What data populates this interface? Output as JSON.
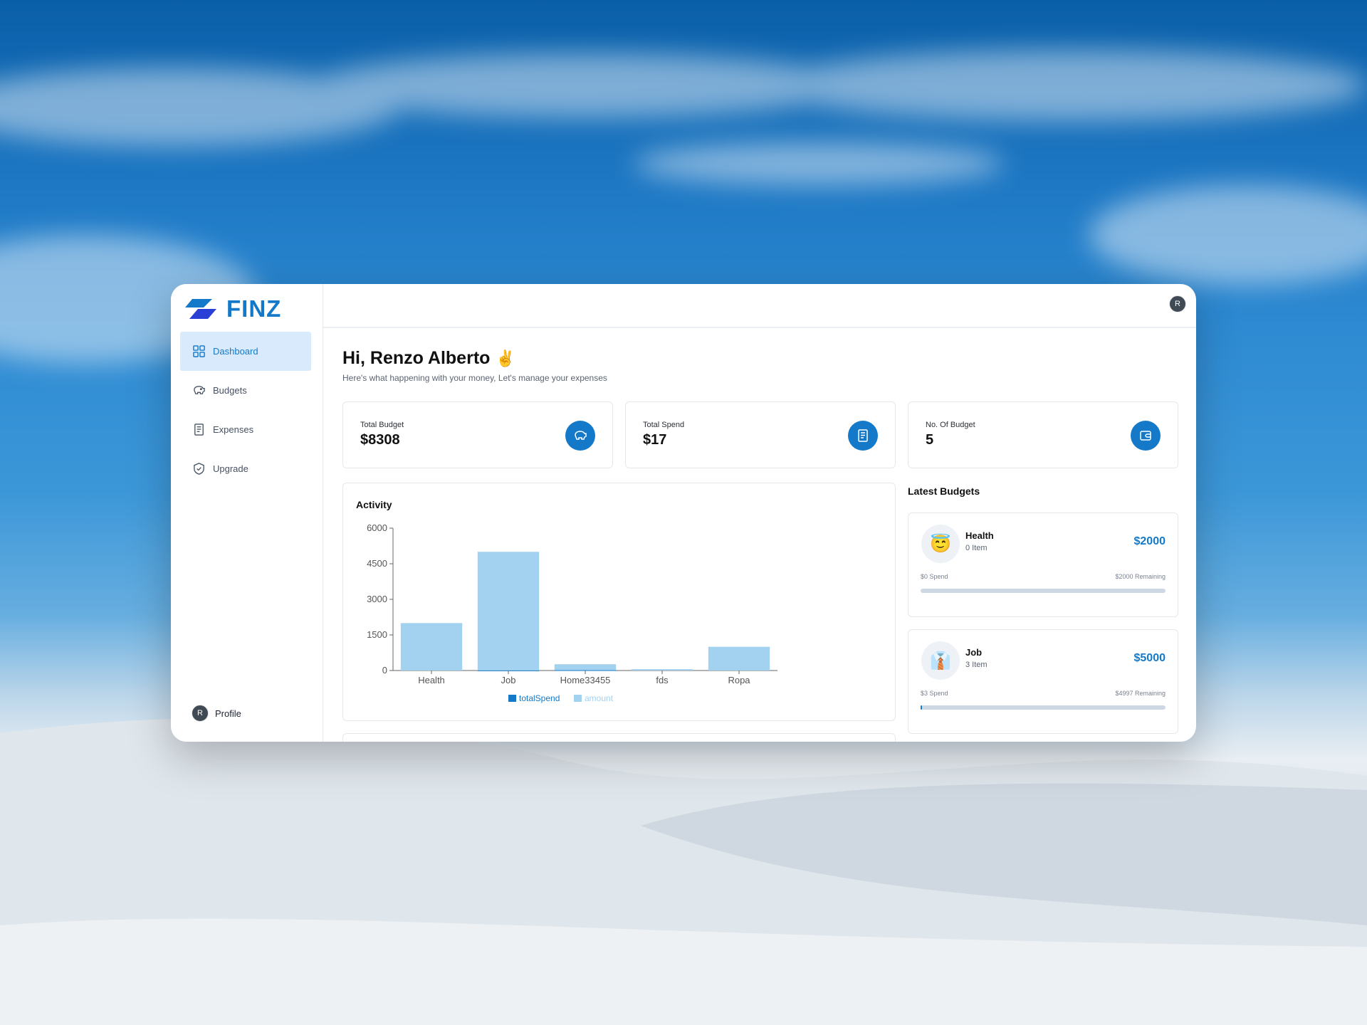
{
  "app": {
    "name": "FINZ"
  },
  "sidebar": {
    "items": [
      {
        "label": "Dashboard",
        "icon": "grid-icon",
        "active": true
      },
      {
        "label": "Budgets",
        "icon": "piggy-bank-icon",
        "active": false
      },
      {
        "label": "Expenses",
        "icon": "receipt-icon",
        "active": false
      },
      {
        "label": "Upgrade",
        "icon": "shield-check-icon",
        "active": false
      }
    ],
    "profile": {
      "initial": "R",
      "label": "Profile"
    }
  },
  "topbar": {
    "avatar_initial": "R"
  },
  "header": {
    "greeting": "Hi, Renzo Alberto",
    "emoji": "✌️",
    "subtitle": "Here's what happening with your money, Let's manage your expenses"
  },
  "stats": [
    {
      "label": "Total Budget",
      "value": "$8308",
      "icon": "piggy-bank-icon"
    },
    {
      "label": "Total Spend",
      "value": "$17",
      "icon": "receipt-icon"
    },
    {
      "label": "No. Of Budget",
      "value": "5",
      "icon": "wallet-icon"
    }
  ],
  "activity": {
    "title": "Activity"
  },
  "chart_data": {
    "type": "bar",
    "title": "Activity",
    "categories": [
      "Health",
      "Job",
      "Home33455",
      "fds",
      "Ropa"
    ],
    "series": [
      {
        "name": "totalSpend",
        "color": "#1479c9",
        "values": [
          0,
          3,
          14,
          0,
          0
        ]
      },
      {
        "name": "amount",
        "color": "#a3d2f0",
        "values": [
          2000,
          5000,
          250,
          58,
          1000
        ]
      }
    ],
    "yticks": [
      0,
      1500,
      3000,
      4500,
      6000
    ],
    "ylim": [
      0,
      6000
    ],
    "legend": "bottom"
  },
  "latest_budgets": {
    "title": "Latest Budgets",
    "items": [
      {
        "name": "Health",
        "items": "0 Item",
        "amount": "$2000",
        "spend": "$0 Spend",
        "remaining": "$2000 Remaining",
        "emoji": "😇",
        "progress": 0
      },
      {
        "name": "Job",
        "items": "3 Item",
        "amount": "$5000",
        "spend": "$3 Spend",
        "remaining": "$4997 Remaining",
        "emoji": "👔",
        "progress": 0.0006
      }
    ]
  },
  "colors": {
    "accent": "#1479c9",
    "active_bg": "#d9eafc",
    "bar": "#a3d2f0"
  }
}
